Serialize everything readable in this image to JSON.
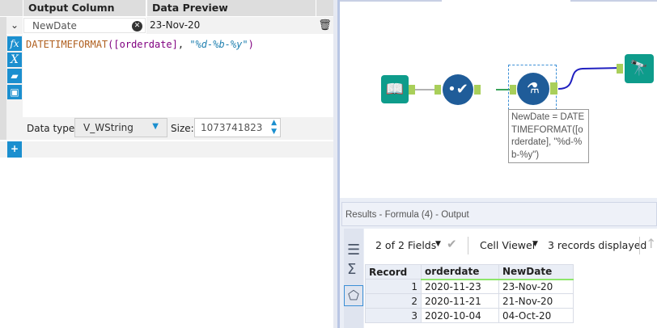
{
  "formula_panel": {
    "headers": {
      "output_column": "Output Column",
      "data_preview": "Data Preview"
    },
    "row": {
      "output_column": "NewDate",
      "preview": "23-Nov-20"
    },
    "expression": {
      "func": "DATETIMEFORMAT",
      "field": "[orderdate]",
      "format": "\"%d-%b-%y\""
    },
    "data_type_label": "Data type:",
    "data_type": "V_WString",
    "size_label": "Size:",
    "size": "1073741823",
    "add_label": "+"
  },
  "canvas": {
    "annotation": "NewDate = DATETIMEFORMAT([orderdate], \"%d-%b-%y\")"
  },
  "results": {
    "title": "Results - Formula (4) - Output",
    "fields": "2 of 2 Fields",
    "viewer": "Cell Viewer",
    "records": "3 records displayed",
    "columns": [
      "Record",
      "orderdate",
      "NewDate"
    ],
    "rows": [
      [
        "1",
        "2020-11-23",
        "23-Nov-20"
      ],
      [
        "2",
        "2020-11-21",
        "21-Nov-20"
      ],
      [
        "3",
        "2020-10-04",
        "04-Oct-20"
      ]
    ]
  },
  "colors": {
    "accent": "#1b8fcf",
    "tool_blue": "#1f5c99",
    "tool_green": "#0e9c8b",
    "anchor": "#a9cf5a"
  }
}
